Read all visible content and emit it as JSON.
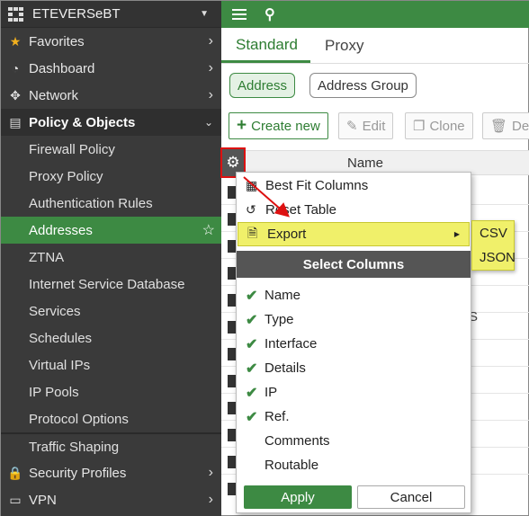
{
  "sidebar": {
    "device_name": "ETEVERSeBT",
    "items": [
      {
        "label": "Favorites",
        "icon": "star-icon"
      },
      {
        "label": "Dashboard",
        "icon": "dashboard-icon"
      },
      {
        "label": "Network",
        "icon": "network-icon"
      },
      {
        "label": "Policy & Objects",
        "icon": "policy-icon"
      }
    ],
    "policy_sub": [
      "Firewall Policy",
      "Proxy Policy",
      "Authentication Rules",
      "Addresses",
      "ZTNA",
      "Internet Service Database",
      "Services",
      "Schedules",
      "Virtual IPs",
      "IP Pools",
      "Protocol Options",
      "Traffic Shaping"
    ],
    "bottom_items": [
      {
        "label": "Security Profiles",
        "icon": "lock-icon"
      },
      {
        "label": "VPN",
        "icon": "vpn-icon"
      }
    ]
  },
  "tabs": [
    "Standard",
    "Proxy"
  ],
  "filters": {
    "address": "Address",
    "address_group": "Address Group"
  },
  "toolbar": {
    "create_new": "Create new",
    "edit": "Edit",
    "clone": "Clone",
    "delete": "Del"
  },
  "table": {
    "name_header": "Name",
    "ghost_text": "S"
  },
  "menu": {
    "best_fit": "Best Fit Columns",
    "reset_table": "Reset Table",
    "export": "Export",
    "select_columns": "Select Columns",
    "columns": [
      {
        "label": "Name",
        "checked": true
      },
      {
        "label": "Type",
        "checked": true
      },
      {
        "label": "Interface",
        "checked": true
      },
      {
        "label": "Details",
        "checked": true
      },
      {
        "label": "IP",
        "checked": true
      },
      {
        "label": "Ref.",
        "checked": true
      },
      {
        "label": "Comments",
        "checked": false
      },
      {
        "label": "Routable",
        "checked": false
      }
    ],
    "apply": "Apply",
    "cancel": "Cancel"
  },
  "export_submenu": [
    "CSV",
    "JSON"
  ],
  "colors": {
    "brand_green": "#3d8a43",
    "highlight_yellow": "#f0f06a",
    "annotation_red": "#dd1111"
  }
}
